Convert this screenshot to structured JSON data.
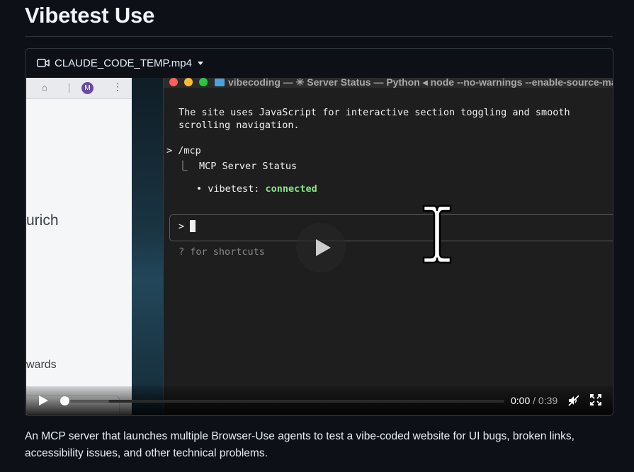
{
  "heading": "Vibetest Use",
  "video": {
    "file_name": "CLAUDE_CODE_TEMP.mp4",
    "browser": {
      "avatar_letter": "M",
      "text_1": "urich",
      "text_2": "wards"
    },
    "terminal": {
      "title": "vibecoding — ✳ Server Status — Python ◂ node --no-warnings --enable-source-ma",
      "line_1": "The site uses JavaScript for interactive section toggling and smooth",
      "line_2": "scrolling navigation.",
      "command": "> /mcp",
      "status_heading": "  ⎿  MCP Server Status",
      "server_bullet": "• vibetest: ",
      "server_state": "connected",
      "prompt": ">",
      "shortcuts_hint": "? for shortcuts"
    },
    "player": {
      "current_time": "0:00",
      "separator": " / ",
      "duration": "0:39",
      "progress": 0.0,
      "buffered": 0.1
    }
  },
  "description": "An MCP server that launches multiple Browser-Use agents to test a vibe-coded website for UI bugs, broken links, accessibility issues, and other technical problems."
}
